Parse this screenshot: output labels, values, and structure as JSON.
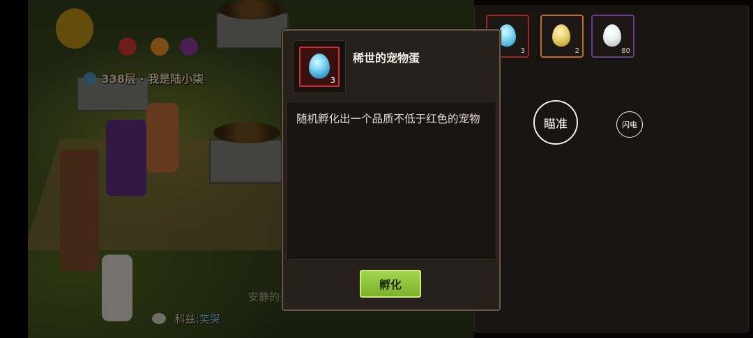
{
  "world": {
    "player_label": "338层 · 我是陆小柒",
    "chat_label": "科兹:",
    "chat_message": "笑哭",
    "faded_text": "安静的头…"
  },
  "inventory": {
    "slots": [
      {
        "count": "3",
        "color": "#a12422",
        "egg": "#7fd8f3"
      },
      {
        "count": "2",
        "color": "#c46d1e",
        "egg": "#e7cf6a"
      },
      {
        "count": "80",
        "color": "#6a3d8c",
        "egg": "#e9eef0"
      }
    ]
  },
  "controls": {
    "aim_label": "瞄准",
    "flash_label": "闪电"
  },
  "modal": {
    "item_name": "稀世的宠物蛋",
    "item_count": "3",
    "description": "随机孵化出一个品质不低于红色的宠物",
    "action_label": "孵化"
  }
}
